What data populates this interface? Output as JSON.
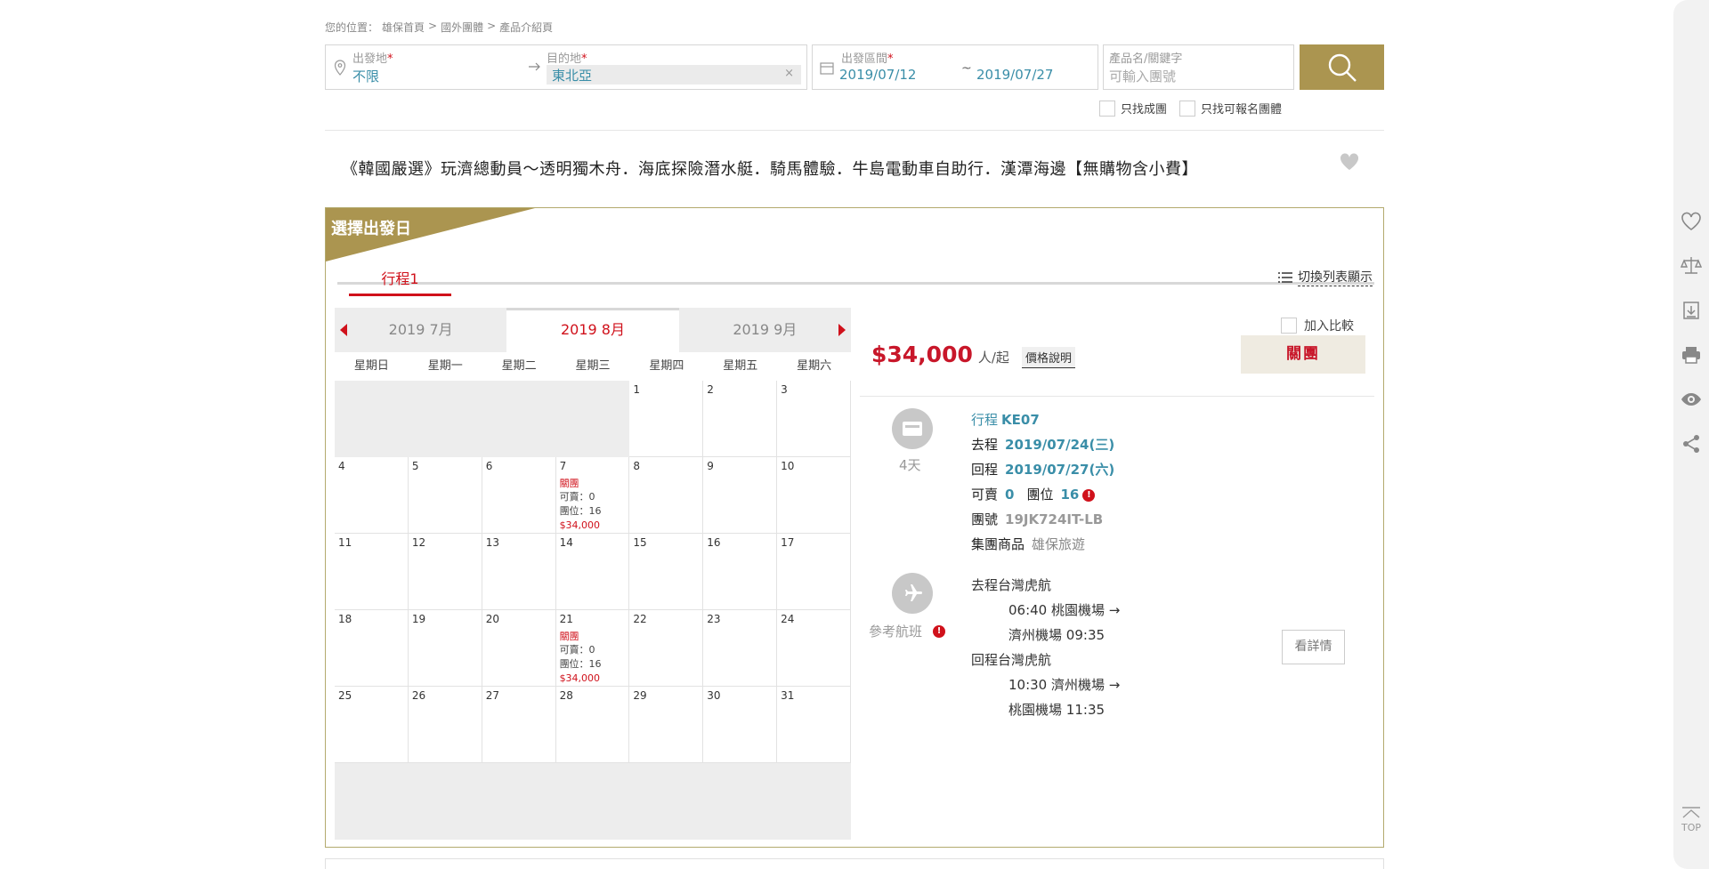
{
  "breadcrumb": {
    "prefix": "您的位置：",
    "home": "雄保首頁",
    "sep1": ">",
    "section": "國外團體",
    "sep2": ">",
    "current": "產品介紹頁"
  },
  "search": {
    "origin_label": "出發地",
    "origin_value": "不限",
    "dest_label": "目的地",
    "dest_value": "東北亞",
    "dest_clear": "×",
    "date_label": "出發區間",
    "date_from": "2019/07/12",
    "date_sep": "~",
    "date_to": "2019/07/27",
    "keyword_label": "產品名/關鍵字",
    "keyword_placeholder": "可輸入團號",
    "required_mark": "*"
  },
  "filters": {
    "confirmed_only": "只找成團",
    "available_only": "只找可報名團體"
  },
  "product": {
    "title": "《韓國嚴選》玩濟總動員～透明獨木舟．海底探險潛水艇．騎馬體驗．牛島電動車自助行．漢潭海邊【無購物含小費】"
  },
  "panel": {
    "ribbon": "選擇出發日",
    "tab1": "行程1",
    "list_view": "切換列表顯示",
    "colors": {
      "gold": "#ab9550",
      "red": "#d0111b",
      "blue": "#3a8ea8"
    }
  },
  "calendar": {
    "months": [
      "2019 7月",
      "2019 8月",
      "2019 9月"
    ],
    "active_month": 1,
    "weekdays": [
      "星期日",
      "星期一",
      "星期二",
      "星期三",
      "星期四",
      "星期五",
      "星期六"
    ],
    "days": [
      "",
      "",
      "",
      "",
      "1",
      "2",
      "3",
      "4",
      "5",
      "6",
      "7",
      "8",
      "9",
      "10",
      "11",
      "12",
      "13",
      "14",
      "15",
      "16",
      "17",
      "18",
      "19",
      "20",
      "21",
      "22",
      "23",
      "24",
      "25",
      "26",
      "27",
      "28",
      "29",
      "30",
      "31"
    ],
    "events": {
      "7": {
        "status": "關團",
        "sellable": "可賣：0",
        "seats": "團位：16",
        "price": "$34,000"
      },
      "21": {
        "status": "關團",
        "sellable": "可賣：0",
        "seats": "團位：16",
        "price": "$34,000"
      }
    }
  },
  "detail": {
    "price": "$34,000",
    "price_unit": "人/起",
    "price_explain": "價格說明",
    "compare_label": "加入比較",
    "status": "關團",
    "days": "4天",
    "itinerary_label": "行程",
    "itinerary_code": "KE07",
    "depart_label": "去程",
    "depart_date": "2019/07/24(三)",
    "return_label": "回程",
    "return_date": "2019/07/27(六)",
    "sellable_label": "可賣",
    "sellable_value": "0",
    "seats_label": "團位",
    "seats_value": "16",
    "group_no_label": "團號",
    "group_no": "19JK724IT-LB",
    "consolidator_label": "集團商品",
    "consolidator": "雄保旅遊",
    "flight_ref_label": "參考航班",
    "outbound_label": "去程",
    "outbound_airline": "台灣虎航",
    "outbound_dep_time": "06:40",
    "outbound_dep_airport": "桃園機場 →",
    "outbound_arr_airport": "濟州機場",
    "outbound_arr_time": "09:35",
    "inbound_label": "回程",
    "inbound_airline": "台灣虎航",
    "inbound_dep_time": "10:30",
    "inbound_dep_airport": "濟州機場 →",
    "inbound_arr_airport": "桃園機場",
    "inbound_arr_time": "11:35",
    "detail_button": "看詳情",
    "warn_mark": "!"
  },
  "sidebar": {
    "top_label": "TOP",
    "icons": [
      "heart-icon",
      "compare-scale-icon",
      "download-icon",
      "print-icon",
      "eye-icon",
      "share-icon"
    ]
  }
}
